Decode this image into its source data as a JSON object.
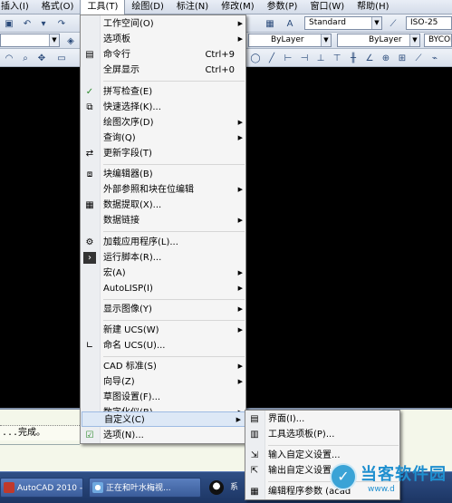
{
  "menubar": {
    "items": [
      "插入(I)",
      "格式(O)",
      "工具(T)",
      "绘图(D)",
      "标注(N)",
      "修改(M)",
      "参数(P)",
      "窗口(W)",
      "帮助(H)"
    ]
  },
  "toolbar": {
    "text_style": "Standard",
    "dim_style": "ISO-25",
    "color": "ByLayer",
    "linetype": "ByLayer",
    "lineweight": "BYCOL"
  },
  "tools_menu": {
    "items": [
      {
        "label": "工作空间(O)"
      },
      {
        "label": "选项板"
      },
      {
        "label": "命令行",
        "shortcut": "Ctrl+9"
      },
      {
        "label": "全屏显示",
        "shortcut": "Ctrl+0"
      },
      {
        "label": "拼写检查(E)"
      },
      {
        "label": "快速选择(K)..."
      },
      {
        "label": "绘图次序(D)"
      },
      {
        "label": "查询(Q)"
      },
      {
        "label": "更新字段(T)"
      },
      {
        "label": "块编辑器(B)"
      },
      {
        "label": "外部参照和块在位编辑"
      },
      {
        "label": "数据提取(X)..."
      },
      {
        "label": "数据链接"
      },
      {
        "label": "加载应用程序(L)..."
      },
      {
        "label": "运行脚本(R)..."
      },
      {
        "label": "宏(A)"
      },
      {
        "label": "AutoLISP(I)"
      },
      {
        "label": "显示图像(Y)"
      },
      {
        "label": "新建 UCS(W)"
      },
      {
        "label": "命名 UCS(U)..."
      },
      {
        "label": "CAD 标准(S)"
      },
      {
        "label": "向导(Z)"
      },
      {
        "label": "草图设置(F)..."
      },
      {
        "label": "数字化仪(B)"
      },
      {
        "label": "自定义(C)"
      },
      {
        "label": "选项(N)..."
      }
    ]
  },
  "customize_submenu": {
    "items": [
      {
        "label": "界面(I)..."
      },
      {
        "label": "工具选项板(P)..."
      },
      {
        "label": "输入自定义设置..."
      },
      {
        "label": "输出自定义设置..."
      },
      {
        "label": "编辑程序参数 (acad"
      }
    ]
  },
  "command_line": {
    "text": "...完成。"
  },
  "taskbar": {
    "tasks": [
      "AutoCAD 2010 -...",
      "正在和叶水梅视..."
    ],
    "extra_label": "系"
  },
  "watermark": {
    "brand": "当客软件园",
    "url": "www.d"
  }
}
